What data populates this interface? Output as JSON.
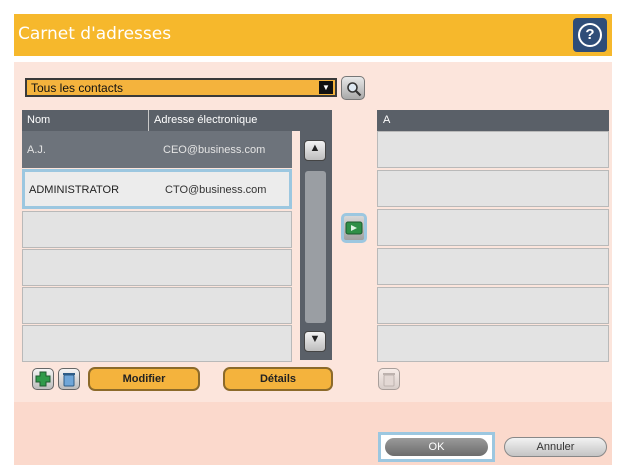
{
  "window": {
    "title": "Carnet d'adresses",
    "help_icon": "question-mark-icon",
    "help_label": "?"
  },
  "filter": {
    "selected": "Tous les contacts",
    "search_icon": "search-icon"
  },
  "contacts_table": {
    "headers": {
      "name": "Nom",
      "email": "Adresse électronique"
    },
    "rows": [
      {
        "name": "A.J.",
        "email": "CEO@business.com"
      },
      {
        "name": "ADMINISTRATOR",
        "email": "CTO@business.com"
      }
    ]
  },
  "scroll": {
    "up_glyph": "▲",
    "down_glyph": "▼"
  },
  "recipients": {
    "header": "A"
  },
  "actions": {
    "modify_label": "Modifier",
    "details_label": "Détails"
  },
  "footer": {
    "ok_label": "OK",
    "cancel_label": "Annuler"
  }
}
